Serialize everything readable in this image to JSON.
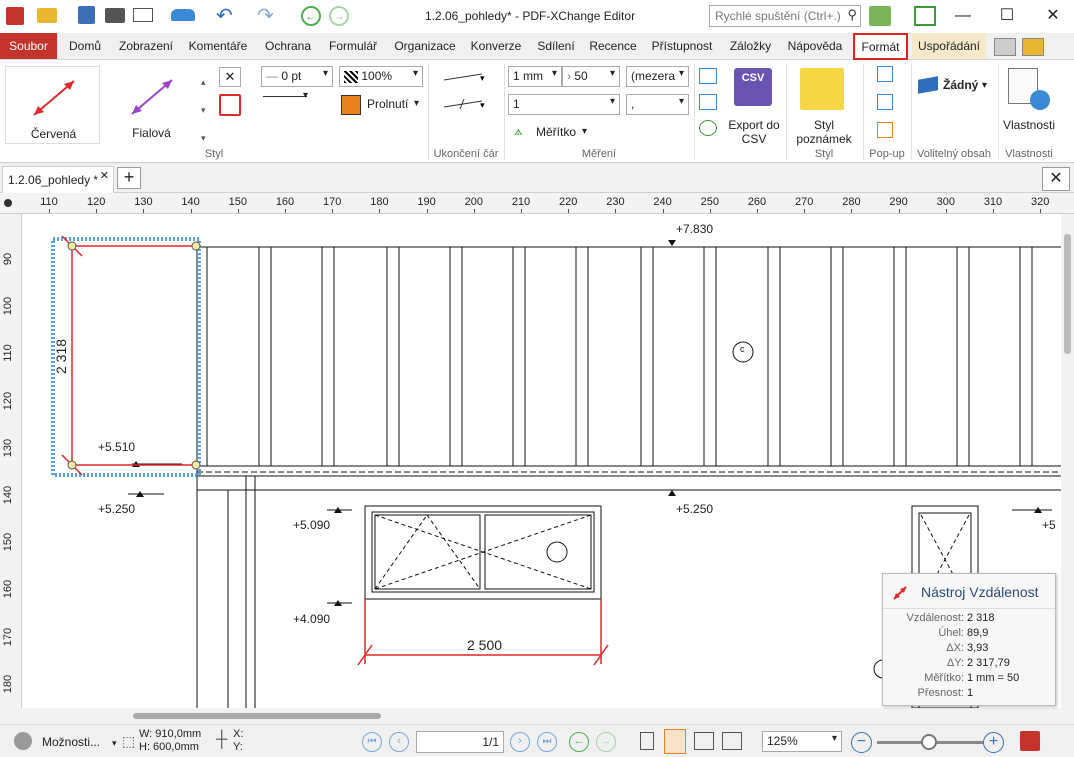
{
  "app": {
    "title": "1.2.06_pohledy* - PDF-XChange Editor",
    "quick_launch_placeholder": "Rychlé spuštění (Ctrl+.)"
  },
  "menu": {
    "items": [
      "Soubor",
      "Domů",
      "Zobrazení",
      "Komentáře",
      "Ochrana",
      "Formulář",
      "Organizace",
      "Konverze",
      "Sdílení",
      "Recence",
      "Přístupnost",
      "Záložky",
      "Nápověda",
      "Formát",
      "Uspořádání"
    ],
    "active": "Formát"
  },
  "ribbon": {
    "style_group": {
      "label": "Styl",
      "presets": [
        "Červená",
        "Fialová"
      ],
      "line_width": "0 pt",
      "opacity": "100%",
      "blend": "Prolnutí"
    },
    "line_end_group": {
      "label": "Ukončení čár"
    },
    "measure_group": {
      "label": "Měření",
      "scale_from": "1 mm",
      "scale_to": "50",
      "precision": "1",
      "separator": "(mezera",
      "decimal": ",",
      "scale_label": "Měřítko"
    },
    "export_group": {
      "label": "Export do CSV"
    },
    "note_style_group": {
      "button": "Styl poznámek",
      "label": "Styl"
    },
    "popup_group": {
      "label": "Pop-up"
    },
    "optional_content_group": {
      "value": "Žádný",
      "label": "Volitelný obsah"
    },
    "properties_group": {
      "button": "Vlastnosti",
      "label": "Vlastnosti"
    }
  },
  "document_tab": {
    "name": "1.2.06_pohledy *"
  },
  "ruler": {
    "h": [
      "110",
      "120",
      "130",
      "140",
      "150",
      "160",
      "170",
      "180",
      "190",
      "200",
      "210",
      "220",
      "230",
      "240",
      "250",
      "260",
      "270",
      "280",
      "290",
      "300",
      "310",
      "320"
    ],
    "v": [
      "90",
      "100",
      "110",
      "120",
      "130",
      "140",
      "150",
      "160",
      "170",
      "180"
    ]
  },
  "drawing": {
    "dim_vertical": "2 318",
    "dim_horizontal": "2 500",
    "levels": [
      "+7.830",
      "+5.510",
      "+5.250",
      "+5.090",
      "+5.250",
      "+4.090",
      "+5"
    ],
    "marker_c": "c"
  },
  "tool_panel": {
    "title": "Nástroj Vzdálenost",
    "rows": [
      {
        "key": "Vzdálenost:",
        "value": "2 318"
      },
      {
        "key": "Úhel:",
        "value": "89,9"
      },
      {
        "key": "ΔX:",
        "value": "3,93"
      },
      {
        "key": "ΔY:",
        "value": "2 317,79"
      },
      {
        "key": "Měřítko:",
        "value": "1 mm = 50"
      },
      {
        "key": "Přesnost:",
        "value": "1"
      }
    ]
  },
  "status": {
    "options": "Možnosti...",
    "width": "W: 910,0mm",
    "height": "H: 600,0mm",
    "x": "X:",
    "y": "Y:",
    "page": "1/1",
    "zoom": "125%"
  }
}
